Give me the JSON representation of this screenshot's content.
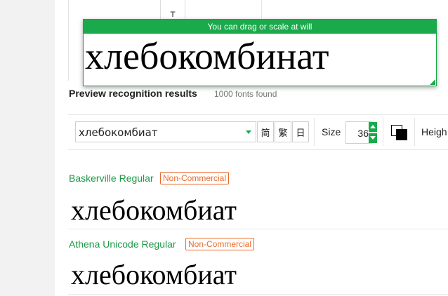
{
  "source_preview": {
    "char": "т"
  },
  "overlay": {
    "hint": "You can drag or scale at will",
    "text": "хлебокомбинат"
  },
  "preview": {
    "title": "Preview recognition results",
    "count": "1000 fonts found"
  },
  "toolbar": {
    "text_value": "хлебокомбиат",
    "script_buttons": [
      "简",
      "繁",
      "日"
    ],
    "size_label": "Size",
    "size_value": "36",
    "height_label": "Heigh"
  },
  "results": [
    {
      "font_name": "Baskerville Regular",
      "license": "Non-Commercial",
      "sample": "хлебокомбиат"
    },
    {
      "font_name": "Athena Unicode Regular",
      "license": "Non-Commercial",
      "sample": "хлебокомбиат"
    }
  ],
  "colors": {
    "accent": "#1aaa4b",
    "badge": "#ea6a2a"
  }
}
